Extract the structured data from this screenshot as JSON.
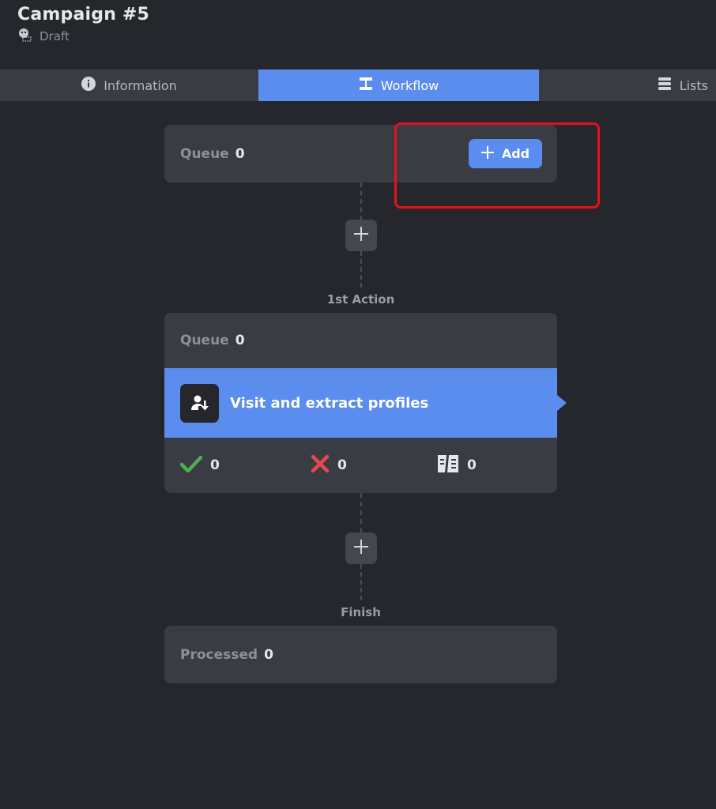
{
  "header": {
    "title": "Campaign #5",
    "status": "Draft"
  },
  "tabs": [
    {
      "label": "Information",
      "icon": "info-icon"
    },
    {
      "label": "Workflow",
      "icon": "workflow-icon",
      "active": true
    },
    {
      "label": "Lists",
      "icon": "list-icon"
    }
  ],
  "start": {
    "queue_label": "Queue",
    "queue_value": "0",
    "add_label": "Add"
  },
  "action1": {
    "step_label": "1st Action",
    "queue_label": "Queue",
    "queue_value": "0",
    "title": "Visit and extract profiles",
    "icon": "user-download-icon",
    "stats": {
      "success": "0",
      "failed": "0",
      "skipped": "0"
    }
  },
  "finish": {
    "step_label": "Finish",
    "processed_label": "Processed",
    "processed_value": "0"
  },
  "colors": {
    "accent": "#5b8def",
    "background": "#25272d",
    "card": "#3a3c43",
    "success": "#4caf50",
    "error": "#e5484d",
    "highlight": "#e8101a"
  }
}
